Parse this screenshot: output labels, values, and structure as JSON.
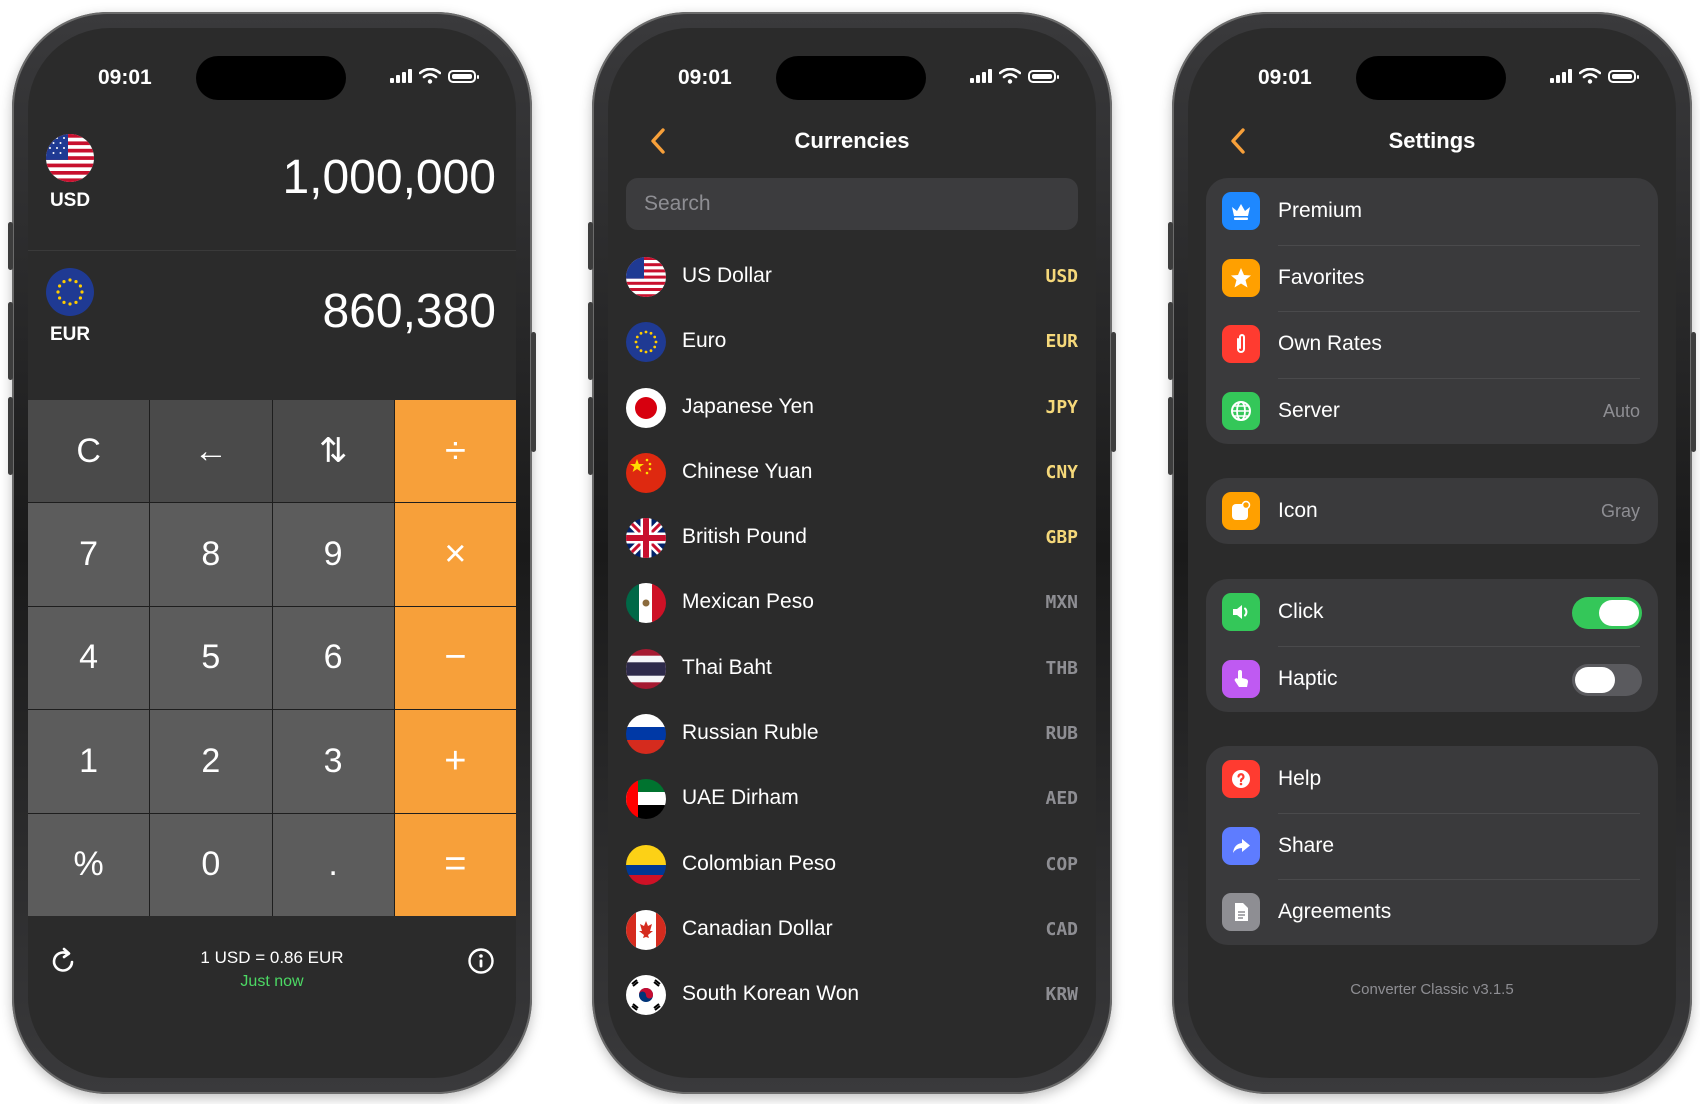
{
  "status_bar": {
    "time": "09:01"
  },
  "converter": {
    "rows": [
      {
        "code": "USD",
        "value": "1,000,000",
        "flag": "us-flag"
      },
      {
        "code": "EUR",
        "value": "860,380",
        "flag": "eu-flag"
      }
    ],
    "keys": [
      [
        "C",
        "←",
        "⇅",
        "÷"
      ],
      [
        "7",
        "8",
        "9",
        "×"
      ],
      [
        "4",
        "5",
        "6",
        "−"
      ],
      [
        "1",
        "2",
        "3",
        "+"
      ],
      [
        "%",
        "0",
        ".",
        "="
      ]
    ],
    "rate_text": "1 USD = 0.86 EUR",
    "updated_text": "Just now",
    "colors": {
      "operator": "#f7a03a",
      "updated": "#4cd964"
    }
  },
  "currencies": {
    "title": "Currencies",
    "search_placeholder": "Search",
    "items": [
      {
        "name": "US Dollar",
        "code": "USD",
        "favorite": true
      },
      {
        "name": "Euro",
        "code": "EUR",
        "favorite": true
      },
      {
        "name": "Japanese Yen",
        "code": "JPY",
        "favorite": true
      },
      {
        "name": "Chinese Yuan",
        "code": "CNY",
        "favorite": true
      },
      {
        "name": "British Pound",
        "code": "GBP",
        "favorite": true
      },
      {
        "name": "Mexican Peso",
        "code": "MXN",
        "favorite": false
      },
      {
        "name": "Thai Baht",
        "code": "THB",
        "favorite": false
      },
      {
        "name": "Russian Ruble",
        "code": "RUB",
        "favorite": false
      },
      {
        "name": "UAE Dirham",
        "code": "AED",
        "favorite": false
      },
      {
        "name": "Colombian Peso",
        "code": "COP",
        "favorite": false
      },
      {
        "name": "Canadian Dollar",
        "code": "CAD",
        "favorite": false
      },
      {
        "name": "South Korean Won",
        "code": "KRW",
        "favorite": false
      }
    ],
    "colors": {
      "favorite_code": "#f5d87a",
      "other_code": "#8e8e93"
    }
  },
  "settings": {
    "title": "Settings",
    "groups": [
      [
        {
          "label": "Premium",
          "icon": "crown-icon",
          "color": "#1e88ff",
          "value": ""
        },
        {
          "label": "Favorites",
          "icon": "star-icon",
          "color": "#ffa000",
          "value": ""
        },
        {
          "label": "Own Rates",
          "icon": "paperclip-icon",
          "color": "#ff3b30",
          "value": ""
        },
        {
          "label": "Server",
          "icon": "globe-icon",
          "color": "#34c759",
          "value": "Auto"
        }
      ],
      [
        {
          "label": "Icon",
          "icon": "app-icon-icon",
          "color": "#ffa000",
          "value": "Gray"
        }
      ],
      [
        {
          "label": "Click",
          "icon": "speaker-icon",
          "color": "#34c759",
          "toggle": true
        },
        {
          "label": "Haptic",
          "icon": "touch-icon",
          "color": "#bf5af2",
          "toggle": false
        }
      ],
      [
        {
          "label": "Help",
          "icon": "question-icon",
          "color": "#ff3b30",
          "value": ""
        },
        {
          "label": "Share",
          "icon": "share-icon",
          "color": "#5e7cff",
          "value": ""
        },
        {
          "label": "Agreements",
          "icon": "document-icon",
          "color": "#8e8e93",
          "value": ""
        }
      ]
    ],
    "version": "Converter Classic v3.1.5",
    "colors": {
      "toggle_on": "#34c759",
      "toggle_off": "#5a5a5e"
    }
  }
}
